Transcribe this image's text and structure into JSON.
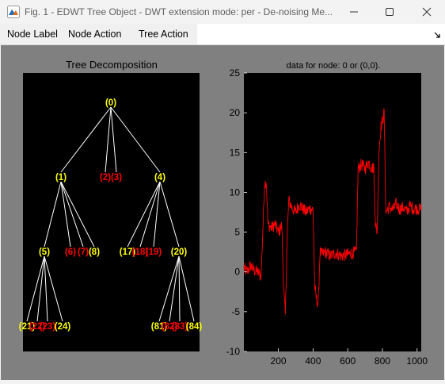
{
  "window": {
    "title": "Fig. 1 - EDWT Tree Object - DWT extension mode: per  -  De-noising Me...",
    "icon": "matlab-figure-icon",
    "controls": [
      "minimize-icon",
      "maximize-icon",
      "close-icon"
    ]
  },
  "menu": {
    "items": [
      "Node Label",
      "Node Action",
      "Tree Action"
    ],
    "expand_icon": "menu-overflow-icon"
  },
  "tree_panel": {
    "title": "Tree Decomposition",
    "nodes": [
      {
        "id": "n0",
        "label": "(0)",
        "color": "yellow"
      },
      {
        "id": "n1",
        "label": "(1)",
        "color": "yellow"
      },
      {
        "id": "n2",
        "label": "(2)",
        "color": "red"
      },
      {
        "id": "n3",
        "label": "(3)",
        "color": "red"
      },
      {
        "id": "n4",
        "label": "(4)",
        "color": "yellow"
      },
      {
        "id": "n5",
        "label": "(5)",
        "color": "yellow"
      },
      {
        "id": "n6",
        "label": "(6)",
        "color": "red"
      },
      {
        "id": "n7",
        "label": "(7)",
        "color": "red"
      },
      {
        "id": "n8",
        "label": "(8)",
        "color": "yellow"
      },
      {
        "id": "n17",
        "label": "(17)",
        "color": "yellow"
      },
      {
        "id": "n18",
        "label": "(18)",
        "color": "red"
      },
      {
        "id": "n19",
        "label": "(19)",
        "color": "red"
      },
      {
        "id": "n20",
        "label": "(20)",
        "color": "yellow"
      },
      {
        "id": "n21",
        "label": "(21)",
        "color": "yellow"
      },
      {
        "id": "n22",
        "label": "(22)",
        "color": "red"
      },
      {
        "id": "n23",
        "label": "(23)",
        "color": "red"
      },
      {
        "id": "n24",
        "label": "(24)",
        "color": "yellow"
      },
      {
        "id": "n81",
        "label": "(81)",
        "color": "yellow"
      },
      {
        "id": "n82",
        "label": "(82)",
        "color": "red"
      },
      {
        "id": "n83",
        "label": "(83)",
        "color": "red"
      },
      {
        "id": "n84",
        "label": "(84)",
        "color": "yellow"
      }
    ],
    "edges": [
      [
        "n0",
        "n1"
      ],
      [
        "n0",
        "n2"
      ],
      [
        "n0",
        "n3"
      ],
      [
        "n0",
        "n4"
      ],
      [
        "n1",
        "n5"
      ],
      [
        "n1",
        "n6"
      ],
      [
        "n1",
        "n7"
      ],
      [
        "n1",
        "n8"
      ],
      [
        "n4",
        "n17"
      ],
      [
        "n4",
        "n18"
      ],
      [
        "n4",
        "n19"
      ],
      [
        "n4",
        "n20"
      ],
      [
        "n5",
        "n21"
      ],
      [
        "n5",
        "n22"
      ],
      [
        "n5",
        "n23"
      ],
      [
        "n5",
        "n24"
      ],
      [
        "n20",
        "n81"
      ],
      [
        "n20",
        "n82"
      ],
      [
        "n20",
        "n83"
      ],
      [
        "n20",
        "n84"
      ]
    ],
    "colors": {
      "background": "#000000",
      "edge": "#ffffff",
      "yellow": "#ffff00",
      "red": "#ff0000"
    }
  },
  "chart_data": {
    "type": "line",
    "title": "data for node: 0 or (0,0).",
    "xlabel": "",
    "ylabel": "",
    "xlim": [
      1,
      1024
    ],
    "ylim": [
      -10,
      25
    ],
    "xticks": [
      200,
      400,
      600,
      800,
      1000
    ],
    "yticks": [
      -10,
      -5,
      0,
      5,
      10,
      15,
      20,
      25
    ],
    "grid": false,
    "series": [
      {
        "color": "#ff0000",
        "x": [
          1,
          20,
          40,
          60,
          80,
          100,
          110,
          120,
          130,
          140,
          160,
          180,
          200,
          220,
          230,
          240,
          250,
          260,
          280,
          300,
          320,
          340,
          360,
          380,
          400,
          410,
          420,
          430,
          440,
          450,
          470,
          500,
          530,
          560,
          600,
          650,
          660,
          680,
          700,
          720,
          740,
          750,
          760,
          770,
          780,
          790,
          800,
          810,
          820,
          840,
          860,
          880,
          900,
          920,
          940,
          960,
          980,
          1000,
          1024
        ],
        "y": [
          0.5,
          0,
          0.8,
          0.2,
          0,
          -0.5,
          5,
          11,
          11.5,
          6,
          5.5,
          6,
          5,
          5.8,
          -2,
          -5.5,
          4,
          9,
          8,
          7.5,
          8.5,
          8,
          7.5,
          8,
          7.8,
          -2,
          -3.5,
          -4,
          2.5,
          2.2,
          2.5,
          2.0,
          2.4,
          2.0,
          2.2,
          2.5,
          13,
          13.5,
          13,
          13.8,
          13,
          13.2,
          6,
          5,
          15,
          18,
          19,
          20,
          7.5,
          8.2,
          7.8,
          8.5,
          7.9,
          8.1,
          7.6,
          8.3,
          7.9,
          8.0,
          7.8
        ]
      }
    ]
  }
}
